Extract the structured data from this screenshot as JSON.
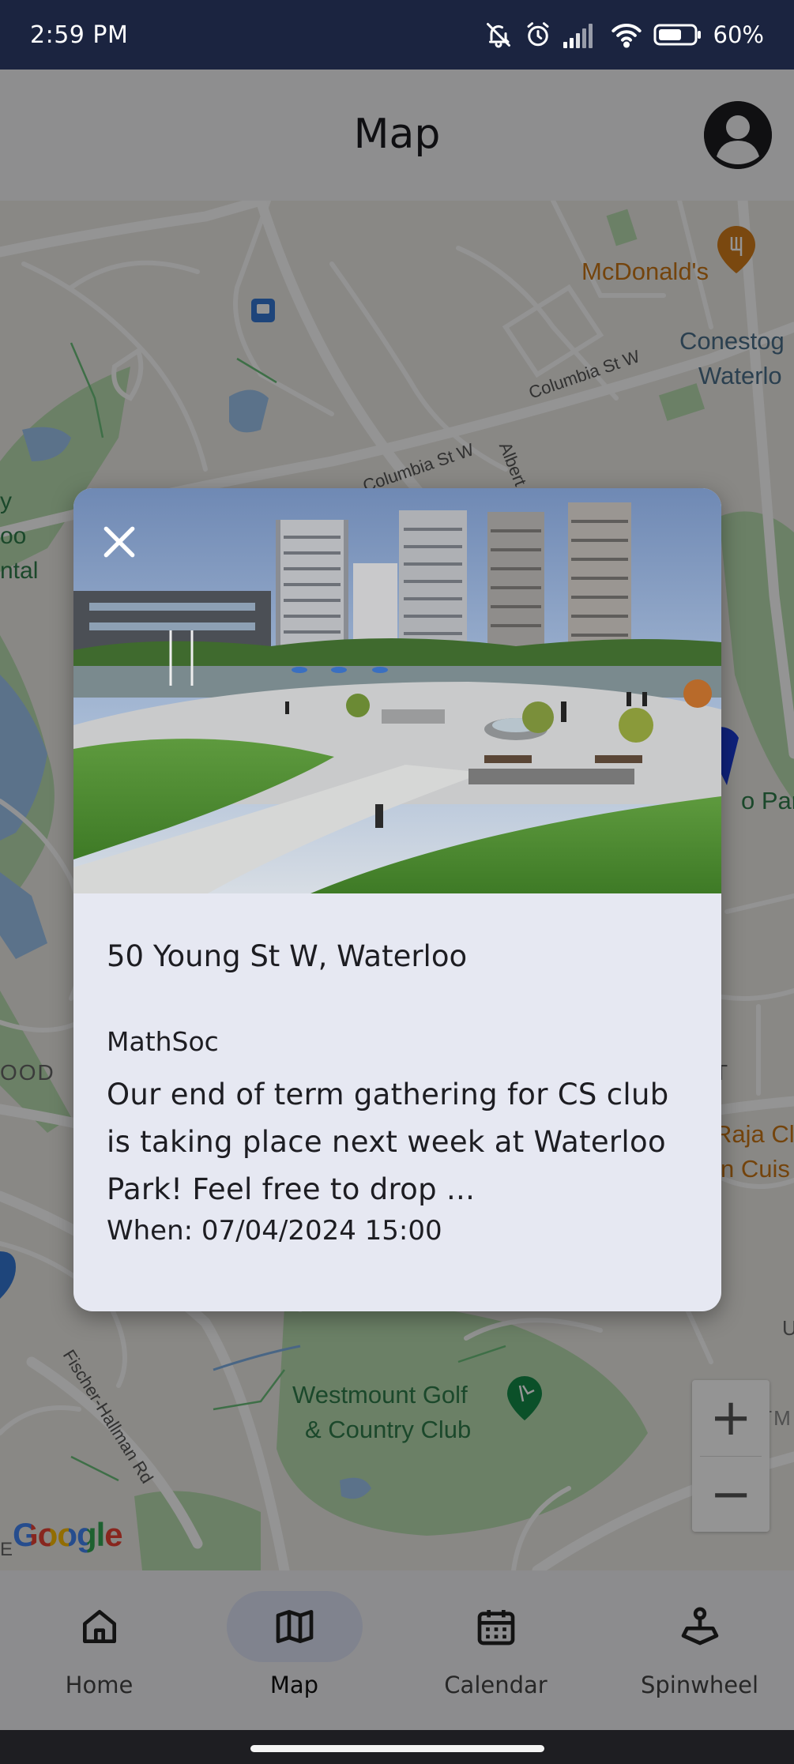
{
  "status_bar": {
    "time": "2:59 PM",
    "battery_percent": "60%",
    "icons": [
      "bell-off-icon",
      "alarm-icon",
      "signal-icon",
      "wifi-icon",
      "battery-icon"
    ]
  },
  "header": {
    "title": "Map",
    "profile_icon": "account-circle-icon"
  },
  "map": {
    "labels": {
      "mcdonalds": "McDonald's",
      "conestoga_1": "Conestog",
      "conestoga_2": "Waterlo",
      "columbia_1": "Columbia St W",
      "columbia_2": "Columbia St W",
      "albert": "Albert",
      "left_y": "y",
      "left_oo": "oo",
      "left_ntal": "ntal",
      "waterloo_park": "o Park",
      "left_ood": "OOD",
      "right_t": "T",
      "raja_1": "Raja Cl",
      "raja_2": "n Cuis",
      "right_u": "U",
      "fischer": "Fischer-Hallman Rd",
      "westmount_1": "Westmount Golf",
      "westmount_2": "& Country Club",
      "westm_partial": "WESTM",
      "left_e": "E"
    },
    "zoom_in": "+",
    "zoom_out": "−",
    "google_logo": "Google",
    "colors": {
      "background": "#eceae6",
      "park": "#b9dcb0",
      "water": "#9ec5ee",
      "road": "#ffffff",
      "poi_orange": "#d27d1a",
      "poi_green": "#138a48",
      "marker_blue": "#1a3bd6"
    }
  },
  "dialog": {
    "close_icon": "close-icon",
    "photo_description_icon": "park-photo",
    "address": "50 Young St W, Waterloo",
    "organizer": "MathSoc",
    "description": "Our end of term gathering for CS club is taking place next week at Waterloo Park! Feel free to drop ...",
    "when": "When: 07/04/2024 15:00"
  },
  "bottom_nav": {
    "items": [
      {
        "label": "Home",
        "icon": "home-icon",
        "active": false
      },
      {
        "label": "Map",
        "icon": "map-icon",
        "active": true
      },
      {
        "label": "Calendar",
        "icon": "calendar-icon",
        "active": false
      },
      {
        "label": "Spinwheel",
        "icon": "joystick-icon",
        "active": false
      }
    ]
  }
}
